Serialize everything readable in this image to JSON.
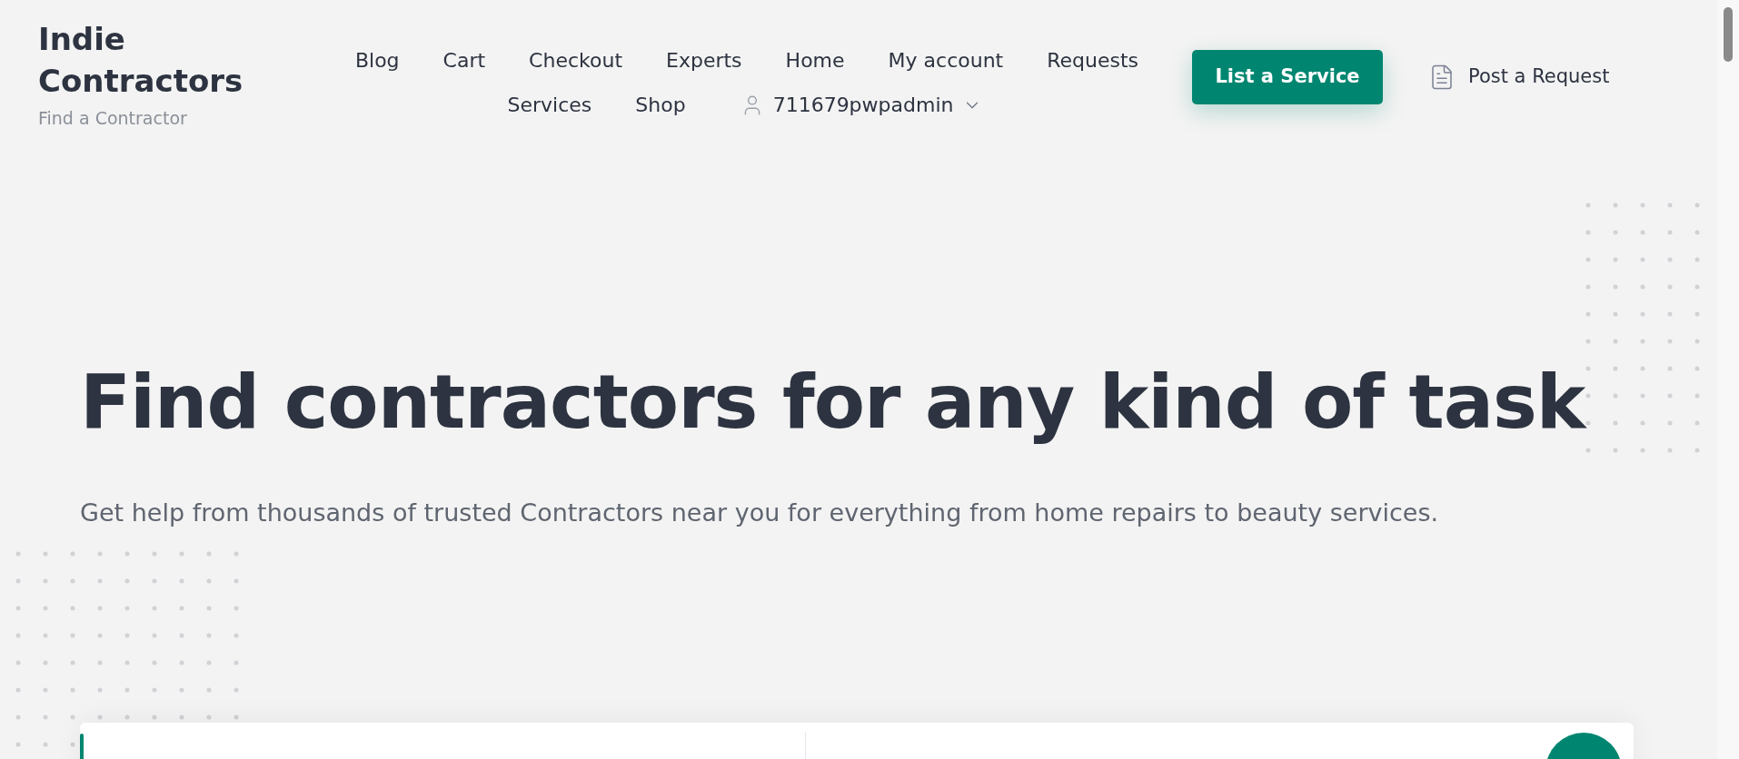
{
  "brand": {
    "title": "Indie Contractors",
    "tagline": "Find a Contractor"
  },
  "nav": {
    "items": [
      "Blog",
      "Cart",
      "Checkout",
      "Experts",
      "Home",
      "My account",
      "Requests",
      "Services",
      "Shop"
    ],
    "user_menu": {
      "label": "711679pwpadmin",
      "expanded": false
    }
  },
  "actions": {
    "primary": "List a Service",
    "secondary": "Post a Request"
  },
  "hero": {
    "heading": "Find contractors for any kind of task",
    "subheading": "Get help from thousands of trusted Contractors near you for everything from home repairs to beauty services."
  }
}
